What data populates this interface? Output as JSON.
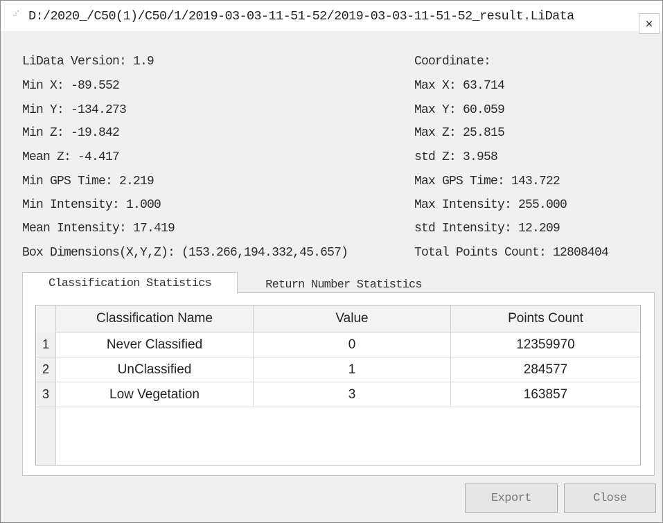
{
  "window": {
    "title": "D:/2020_/C50(1)/C50/1/2019-03-03-11-51-52/2019-03-03-11-51-52_result.LiData",
    "close_glyph": "×"
  },
  "info": {
    "left": [
      "LiData Version: 1.9",
      "Min X: -89.552",
      "Min Y: -134.273",
      "Min Z: -19.842",
      "Mean Z: -4.417",
      "Min GPS Time: 2.219",
      "Min Intensity: 1.000",
      "Mean Intensity: 17.419",
      "Box Dimensions(X,Y,Z): (153.266,194.332,45.657)"
    ],
    "right": [
      "Coordinate:",
      "Max X: 63.714",
      "Max Y: 60.059",
      "Max Z: 25.815",
      "std Z: 3.958",
      "Max GPS Time: 143.722",
      "Max Intensity: 255.000",
      "std Intensity: 12.209",
      "Total Points Count: 12808404"
    ]
  },
  "tabs": {
    "classification": "Classification Statistics",
    "return_number": "Return Number Statistics"
  },
  "table": {
    "headers": [
      "Classification Name",
      "Value",
      "Points Count"
    ],
    "rows": [
      {
        "num": "1",
        "name": "Never Classified",
        "value": "0",
        "count": "12359970"
      },
      {
        "num": "2",
        "name": "UnClassified",
        "value": "1",
        "count": "284577"
      },
      {
        "num": "3",
        "name": "Low Vegetation",
        "value": "3",
        "count": "163857"
      }
    ]
  },
  "buttons": {
    "export": "Export",
    "close": "Close"
  }
}
